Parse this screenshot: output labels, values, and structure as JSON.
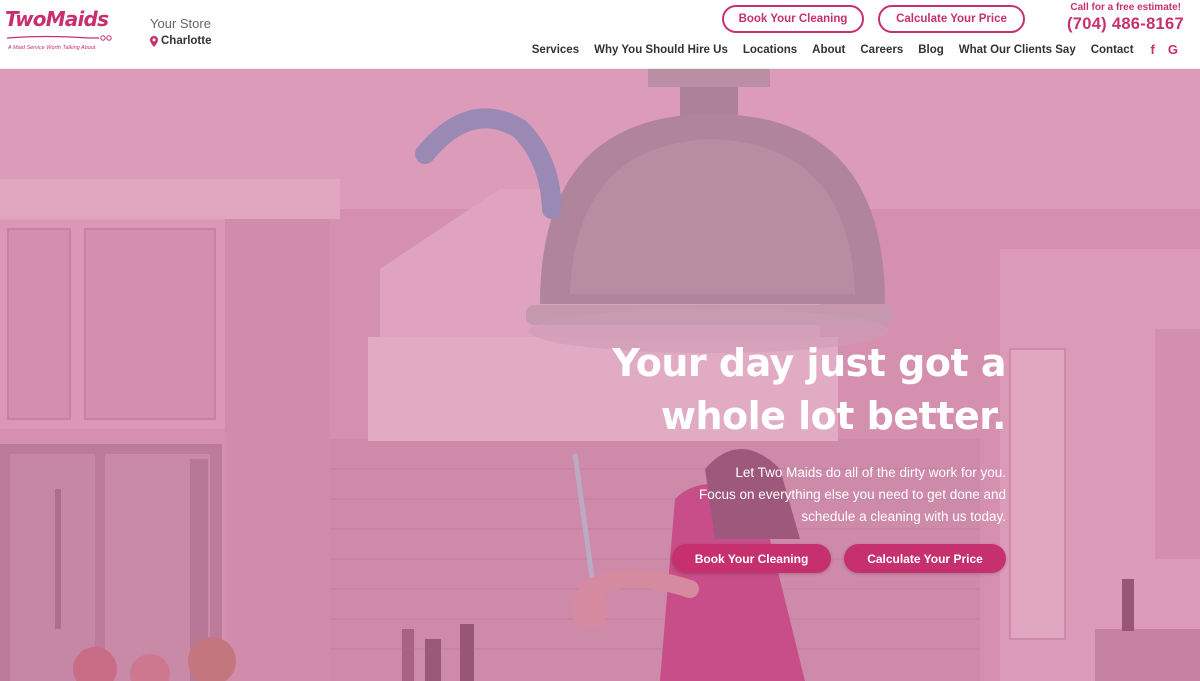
{
  "brand": {
    "logo_text": "TwoMaids",
    "tagline": "A Maid Service Worth Talking About",
    "accent_color": "#c7306f"
  },
  "store": {
    "label": "Your Store",
    "city": "Charlotte",
    "icon": "map-pin-icon"
  },
  "header": {
    "book_label": "Book Your Cleaning",
    "calc_label": "Calculate Your Price",
    "cta_label": "Call for a free estimate!",
    "phone": "(704) 486-8167"
  },
  "nav": {
    "items": [
      "Services",
      "Why You Should Hire Us",
      "Locations",
      "About",
      "Careers",
      "Blog",
      "What Our Clients Say",
      "Contact"
    ],
    "social": [
      {
        "name": "facebook-icon",
        "glyph": "f"
      },
      {
        "name": "google-icon",
        "glyph": "G"
      }
    ]
  },
  "hero": {
    "title_line1": "Your day just got a",
    "title_line2": "whole lot better.",
    "subtitle_line1": "Let Two Maids do all of the dirty work for you.",
    "subtitle_line2": "Focus on everything else you need to get done and",
    "subtitle_line3": "schedule a cleaning with us today.",
    "book_label": "Book Your Cleaning",
    "calc_label": "Calculate Your Price"
  }
}
